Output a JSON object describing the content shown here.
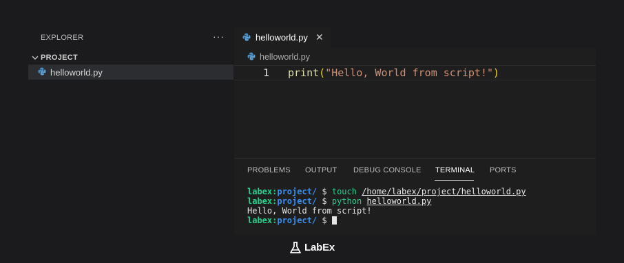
{
  "sidebar": {
    "title": "EXPLORER",
    "more_icon": "···",
    "section": "PROJECT",
    "files": [
      {
        "name": "helloworld.py",
        "icon": "python-file-icon"
      }
    ]
  },
  "editor": {
    "tab": {
      "label": "helloworld.py",
      "close": "✕"
    },
    "breadcrumb": "helloworld.py",
    "lines": [
      {
        "number": "1",
        "fn": "print",
        "open": "(",
        "string": "\"Hello, World from script!\"",
        "close": ")"
      }
    ]
  },
  "panel": {
    "tabs": [
      "PROBLEMS",
      "OUTPUT",
      "DEBUG CONSOLE",
      "TERMINAL",
      "PORTS"
    ],
    "active_tab": "TERMINAL",
    "terminal": {
      "user": "labex:",
      "path": "project/",
      "prompt": " $ ",
      "lines": [
        {
          "cmd": "touch",
          "arg": "/home/labex/project/helloworld.py"
        },
        {
          "cmd": "python",
          "arg": "helloworld.py"
        }
      ],
      "output": "Hello, World from script!"
    }
  },
  "brand": {
    "name": "LabEx"
  },
  "colors": {
    "background": "#1b1b1d",
    "editor_bg": "#1e1e1f",
    "terminal_user": "#23d18b",
    "terminal_path": "#3b8eea",
    "string": "#ce9178",
    "function": "#dcdcaa"
  }
}
